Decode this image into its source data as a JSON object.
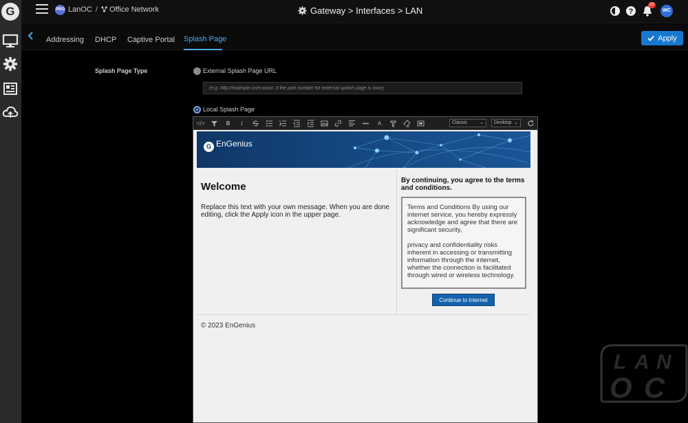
{
  "topbar": {
    "pro_badge": "PRO",
    "org_name": "LanOC",
    "org_separator": "/",
    "network_name": "Office Network",
    "breadcrumb": "Gateway > Interfaces > LAN",
    "notification_count": "23",
    "avatar_initials": "WC",
    "icons": [
      "menu-icon",
      "network-icon",
      "gear-icon",
      "theme-toggle-icon",
      "help-icon",
      "bell-icon"
    ]
  },
  "rail": {
    "logo": "G",
    "icons": [
      "monitor-icon",
      "settings-gear-icon",
      "dashboard-icon",
      "cloud-icon"
    ]
  },
  "tabs": [
    {
      "label": "Addressing"
    },
    {
      "label": "DHCP"
    },
    {
      "label": "Captive Portal"
    },
    {
      "label": "Splash Page",
      "active": true
    }
  ],
  "apply_label": "Apply",
  "splash": {
    "type_label": "Splash Page Type",
    "external_label": "External Splash Page URL",
    "external_placeholder": "(e.g. http://example.com:xxxx/, if the port number for external splash page is xxxx)",
    "local_label": "Local Splash Page",
    "selected": "local"
  },
  "editor": {
    "toolbar_icons": [
      "code-icon",
      "format-icon",
      "bold-icon",
      "italic-icon",
      "strikethrough-icon",
      "bullet-list-icon",
      "numbered-list-icon",
      "outdent-icon",
      "indent-icon",
      "image-icon",
      "link-icon",
      "align-icon",
      "horizontal-rule-icon",
      "font-color-icon",
      "highlight-icon",
      "clear-format-icon",
      "media-icon"
    ],
    "toolbar_labels": {
      "bold": "B",
      "italic": "I",
      "font_color": "A"
    },
    "theme_select": "Classic",
    "device_select": "Desktop",
    "brand": "EnGenius",
    "brand_mark": "G",
    "welcome_title": "Welcome",
    "welcome_message": "Replace this text with your own message. When you are done editing, click the Apply icon in the upper page.",
    "agree_text": "By continuing, you agree to the terms and conditions.",
    "terms_p1": "Terms and Conditions By using our internet service, you hereby expressly acknowledge and agree that there are significant security,",
    "terms_p2": "privacy and confidentiality risks inherent in accessing or transmitting information through the internet, whether the connection is facilitated through wired or wireless technology.",
    "continue_label": "Continue to Internet",
    "footer": "© 2023 EnGenius"
  },
  "colors": {
    "accent": "#4fa9e6",
    "apply_button": "#1778cf",
    "continue_button": "#1462ad",
    "banner": "#123a6b"
  }
}
